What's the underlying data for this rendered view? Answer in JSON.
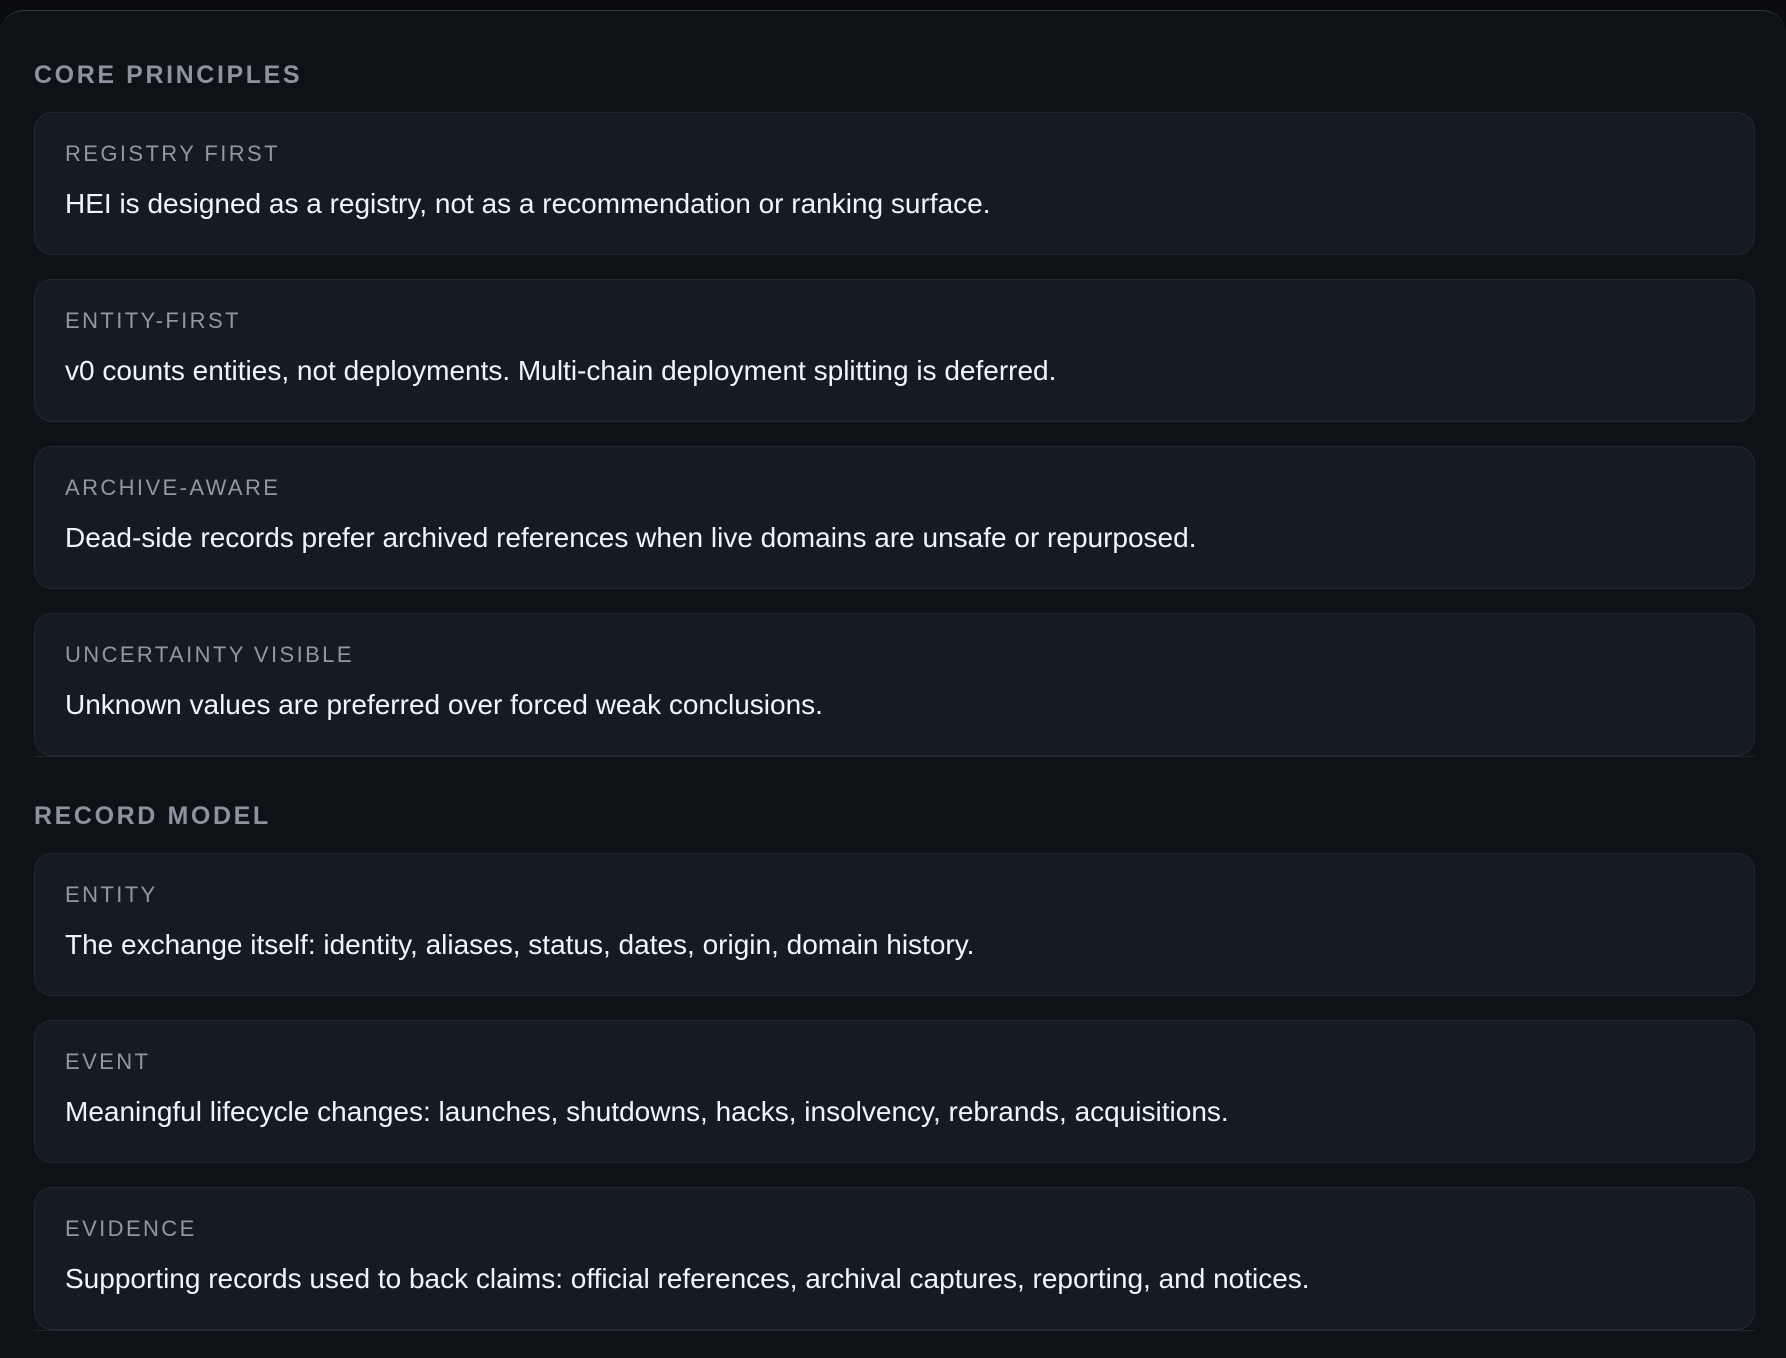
{
  "sections": [
    {
      "title": "CORE PRINCIPLES",
      "cards": [
        {
          "label": "REGISTRY FIRST",
          "text": "HEI is designed as a registry, not as a recommendation or ranking surface."
        },
        {
          "label": "ENTITY-FIRST",
          "text": "v0 counts entities, not deployments. Multi-chain deployment splitting is deferred."
        },
        {
          "label": "ARCHIVE-AWARE",
          "text": "Dead-side records prefer archived references when live domains are unsafe or repurposed."
        },
        {
          "label": "UNCERTAINTY VISIBLE",
          "text": "Unknown values are preferred over forced weak conclusions."
        }
      ]
    },
    {
      "title": "RECORD MODEL",
      "cards": [
        {
          "label": "ENTITY",
          "text": "The exchange itself: identity, aliases, status, dates, origin, domain history."
        },
        {
          "label": "EVENT",
          "text": "Meaningful lifecycle changes: launches, shutdowns, hacks, insolvency, rebrands, acquisitions."
        },
        {
          "label": "EVIDENCE",
          "text": "Supporting records used to back claims: official references, archival captures, reporting, and notices."
        }
      ]
    }
  ]
}
